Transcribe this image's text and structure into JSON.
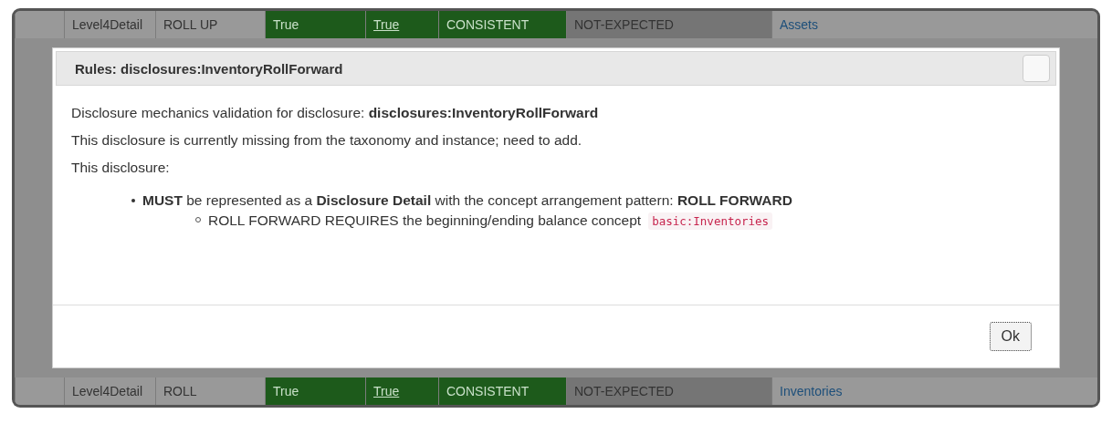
{
  "background_table": {
    "rows": [
      {
        "cells": [
          {
            "kind": "blank"
          },
          {
            "kind": "plain",
            "text": "Level4Detail"
          },
          {
            "kind": "plain",
            "text": "ROLL UP"
          },
          {
            "kind": "pass",
            "text": "True"
          },
          {
            "kind": "pass_link",
            "text": "True"
          },
          {
            "kind": "pass",
            "text": "CONSISTENT"
          },
          {
            "kind": "muted",
            "text": "NOT-EXPECTED"
          },
          {
            "kind": "link",
            "text": "Assets"
          }
        ]
      },
      {
        "cells": [
          {
            "kind": "blank"
          },
          {
            "kind": "plain",
            "text": "Level4Detail"
          },
          {
            "kind": "plain",
            "text": "ROLL"
          },
          {
            "kind": "pass",
            "text": "True"
          },
          {
            "kind": "pass_link",
            "text": "True"
          },
          {
            "kind": "pass",
            "text": "CONSISTENT"
          },
          {
            "kind": "muted",
            "text": "NOT-EXPECTED"
          },
          {
            "kind": "link",
            "text": "Inventories"
          }
        ]
      }
    ]
  },
  "dialog": {
    "title": "Rules: disclosures:InventoryRollForward",
    "paragraphs": [
      "Disclosure mechanics validation for disclosure: **disclosures:InventoryRollForward**",
      "This disclosure is currently missing from the taxonomy and instance; need to add.",
      "This disclosure:"
    ],
    "rules": [
      {
        "text": "**MUST** be represented as a **Disclosure Detail** with the concept arrangement pattern: **ROLL FORWARD**",
        "children": [
          {
            "text": "ROLL FORWARD REQUIRES the beginning/ending balance concept",
            "code": "basic:Inventories"
          }
        ]
      }
    ],
    "buttons": [
      "Ok"
    ]
  }
}
